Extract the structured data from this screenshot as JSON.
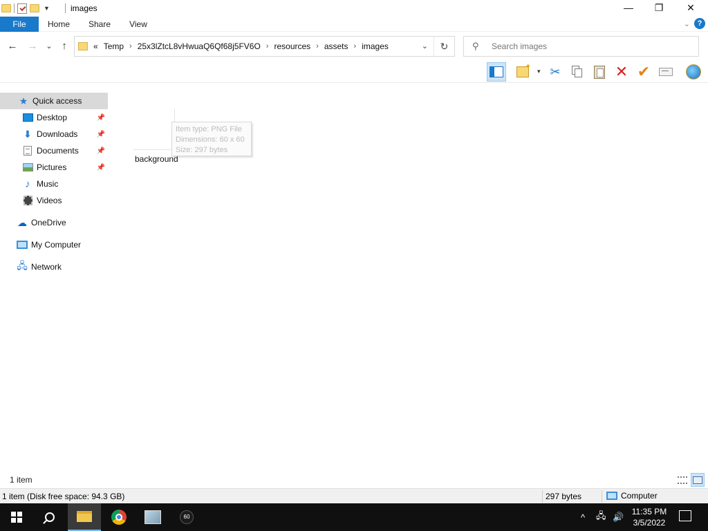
{
  "window": {
    "title": "images",
    "minimize": "—",
    "maximize": "❐",
    "close": "✕"
  },
  "ribbon": {
    "tabs": [
      "File",
      "Home",
      "Share",
      "View"
    ],
    "help": "?",
    "expand": "⌄"
  },
  "nav": {
    "back": "←",
    "forward": "→",
    "recent": "⌄",
    "up": "↑"
  },
  "address": {
    "overflow": "«",
    "crumbs": [
      "Temp",
      "25x3lZtcL8vHwuaQ6Qf68j5FV6O",
      "resources",
      "assets",
      "images"
    ],
    "separator": "›",
    "dropdown": "⌄",
    "refresh": "↻"
  },
  "search": {
    "placeholder": "Search images"
  },
  "toolbar": {
    "icons": [
      "preview-pane-icon",
      "new-item-icon",
      "cut-icon",
      "copy-icon",
      "paste-icon",
      "delete-icon",
      "properties-check-icon",
      "rename-icon",
      "globe-icon"
    ],
    "dropdown": "▾"
  },
  "sidebar": {
    "items": [
      {
        "label": "Quick access",
        "icon": "star-icon",
        "pinned": false
      },
      {
        "label": "Desktop",
        "icon": "desktop-icon",
        "pinned": true
      },
      {
        "label": "Downloads",
        "icon": "downloads-icon",
        "pinned": true
      },
      {
        "label": "Documents",
        "icon": "documents-icon",
        "pinned": true
      },
      {
        "label": "Pictures",
        "icon": "pictures-icon",
        "pinned": true
      },
      {
        "label": "Music",
        "icon": "music-icon",
        "pinned": false
      },
      {
        "label": "Videos",
        "icon": "videos-icon",
        "pinned": false
      },
      {
        "label": "OneDrive",
        "icon": "onedrive-icon",
        "pinned": false
      },
      {
        "label": "My Computer",
        "icon": "computer-icon",
        "pinned": false
      },
      {
        "label": "Network",
        "icon": "network-icon",
        "pinned": false
      }
    ],
    "pin_glyph": "📌"
  },
  "files": [
    {
      "name": "background"
    }
  ],
  "tooltip": {
    "type": "Item type: PNG File",
    "dimensions": "Dimensions: 60 x 60",
    "size": "Size: 297 bytes"
  },
  "status": {
    "count": "1 item",
    "detail": "1 item (Disk free space: 94.3 GB)",
    "size": "297 bytes",
    "location": "Computer"
  },
  "taskbar": {
    "apps": [
      "start-icon",
      "search-icon",
      "file-explorer-icon",
      "chrome-icon",
      "app-icon",
      "media-app-icon"
    ],
    "app4_text": "60",
    "tray_up": "^",
    "network": "🖧",
    "volume": "🔊",
    "time": "11:35 PM",
    "date": "3/5/2022"
  },
  "colors": {
    "accent": "#1979ca",
    "selected_nav": "#d9d9d9",
    "taskbar": "#101010"
  }
}
